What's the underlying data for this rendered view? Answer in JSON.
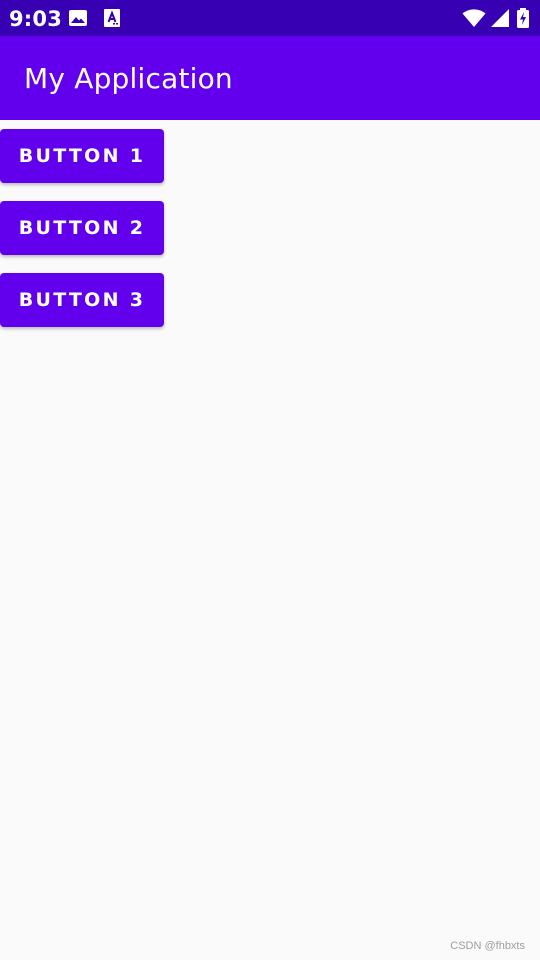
{
  "status_bar": {
    "time": "9:03",
    "background_color": "#3700b3",
    "left_icons": [
      "image-icon",
      "text-a-icon"
    ],
    "right_icons": [
      "wifi-icon",
      "cellular-signal-icon",
      "battery-charging-icon"
    ]
  },
  "app_bar": {
    "title": "My Application",
    "background_color": "#6200ee"
  },
  "buttons": [
    {
      "label": "BUTTON 1"
    },
    {
      "label": "BUTTON 2"
    },
    {
      "label": "BUTTON 3"
    }
  ],
  "colors": {
    "accent": "#6200ee",
    "status_bar": "#3700b3",
    "background": "#fafafa"
  },
  "watermark": "CSDN @fhbxts"
}
